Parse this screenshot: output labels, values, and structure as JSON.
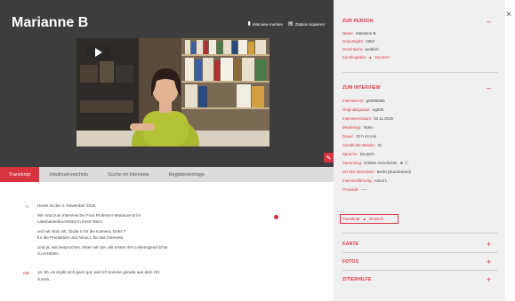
{
  "header": {
    "title": "Marianne B",
    "links": [
      {
        "icon": "bookmark-icon",
        "label": "Interview merken"
      },
      {
        "icon": "doc-icon",
        "label": "Zitation kopieren"
      }
    ]
  },
  "tabs": [
    {
      "label": "Transkript",
      "active": true
    },
    {
      "label": "Inhaltsverzeichnis",
      "active": false
    },
    {
      "label": "Suche im Interview",
      "active": false
    },
    {
      "label": "Registereinträge",
      "active": false
    }
  ],
  "transcript": {
    "lines": [
      "Heute ist der 4. November 2019.",
      "Wir sind zum Interview bei Frau Professor Marianne B   im",
      "Lateinamerika-Institut in ihrem Büro,",
      "und wir sind, äh, Giulia S        für die Kamera, Doris T",
      "für die Produktion und Almut L      für das Interview.",
      "Und ja, wie besprochen, bitten wir Sie, als erstes Ihre Lebensgeschichte",
      "zu erzählen.",
      "Ja, äh, es ergibt sich ganz gut, weil ich komme gerade aus dem Ort",
      "zurück,"
    ],
    "speakers": [
      "AL",
      "MB"
    ]
  },
  "sidebar": {
    "person": {
      "heading": "ZUR PERSON",
      "rows": [
        {
          "k": "Name:",
          "v": "Marianne B"
        },
        {
          "k": "Geburtsjahr:",
          "v": "1953"
        },
        {
          "k": "Geschlecht:",
          "v": "weiblich"
        },
        {
          "k": "Kurzbiografie:",
          "v": "Deutsch"
        }
      ]
    },
    "interview": {
      "heading": "ZUM INTERVIEW",
      "rows": [
        {
          "k": "Interview-ID:",
          "v": "gr0000066"
        },
        {
          "k": "Originalsignatur:",
          "v": "eg035"
        },
        {
          "k": "Interview-Datum:",
          "v": "04.11.2019"
        },
        {
          "k": "Medientyp:",
          "v": "Video"
        },
        {
          "k": "Dauer:",
          "v": "02 h 44 min"
        },
        {
          "k": "Anzahl der Bänder:",
          "v": "01"
        },
        {
          "k": "Sprache:",
          "v": "Deutsch"
        },
        {
          "k": "Sammlung:",
          "v": "Erlebte Geschichte"
        },
        {
          "k": "Ort des Interviews:",
          "v": "Berlin (Bundesland)"
        },
        {
          "k": "Interviewführung:",
          "v": "Almut L"
        },
        {
          "k": "Protokoll:",
          "v": "-----"
        },
        {
          "k": "Transkript:",
          "v": "Deutsch"
        }
      ]
    },
    "collapsed": [
      {
        "label": "KARTE"
      },
      {
        "label": "FOTOS"
      },
      {
        "label": "ZITIERHILFE"
      }
    ],
    "toggle_open": "–",
    "toggle_closed": "+",
    "close": "×"
  },
  "colors": {
    "accent": "#d9333f",
    "dark": "#3d3d3d",
    "panel": "#f0f0f0"
  }
}
